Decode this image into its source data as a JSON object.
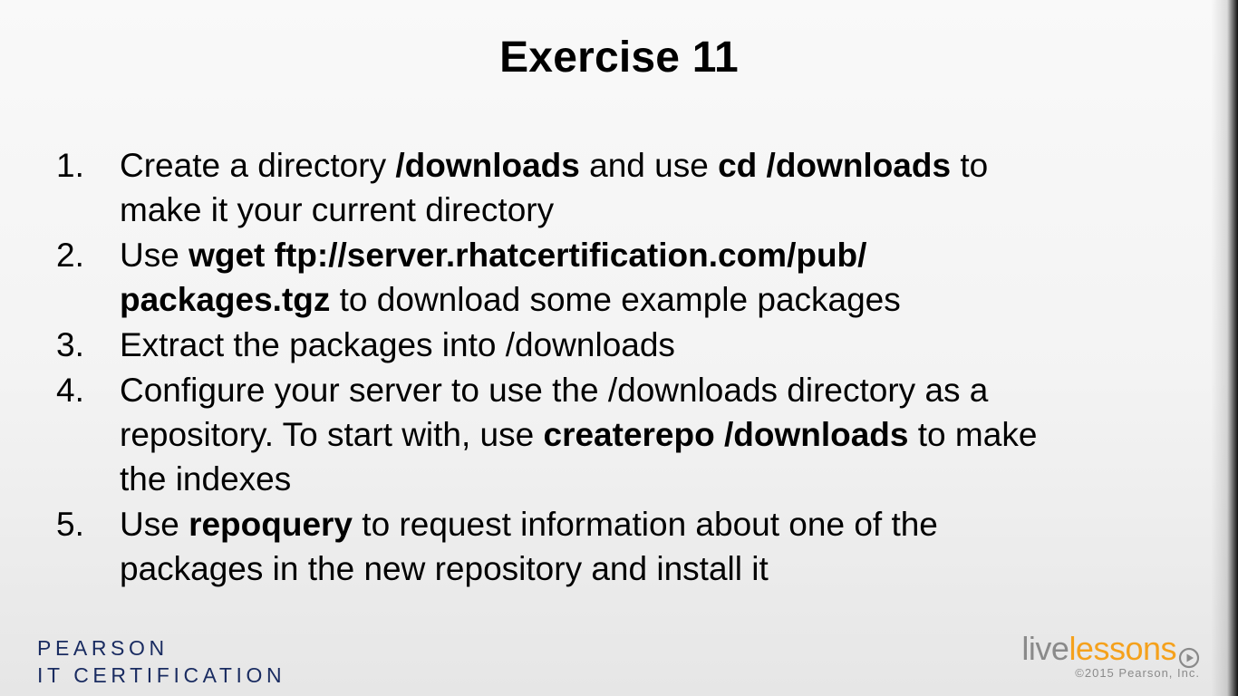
{
  "slide": {
    "title": "Exercise 11",
    "steps": [
      {
        "number": "1.",
        "line1": [
          {
            "text": "Create a directory ",
            "bold": false
          },
          {
            "text": "/downloads",
            "bold": true
          },
          {
            "text": " and use ",
            "bold": false
          },
          {
            "text": "cd /downloads",
            "bold": true
          },
          {
            "text": " to",
            "bold": false
          }
        ],
        "line2": [
          {
            "text": "make it your current directory",
            "bold": false
          }
        ]
      },
      {
        "number": "2.",
        "line1": [
          {
            "text": "Use ",
            "bold": false
          },
          {
            "text": "wget ftp://server.rhatcertification.com/pub/",
            "bold": true
          }
        ],
        "line2": [
          {
            "text": "packages.tgz",
            "bold": true
          },
          {
            "text": " to download some example packages",
            "bold": false
          }
        ]
      },
      {
        "number": "3.",
        "line1": [
          {
            "text": "Extract the packages into /downloads",
            "bold": false
          }
        ]
      },
      {
        "number": "4.",
        "line1": [
          {
            "text": "Configure your server to use the /downloads directory as a",
            "bold": false
          }
        ],
        "line2": [
          {
            "text": "repository. To start with, use ",
            "bold": false
          },
          {
            "text": "createrepo /downloads",
            "bold": true
          },
          {
            "text": " to make",
            "bold": false
          }
        ],
        "line3": [
          {
            "text": "the indexes",
            "bold": false
          }
        ]
      },
      {
        "number": "5.",
        "line1": [
          {
            "text": "Use ",
            "bold": false
          },
          {
            "text": "repoquery",
            "bold": true
          },
          {
            "text": " to request information about one of the",
            "bold": false
          }
        ],
        "line2": [
          {
            "text": "packages in the new repository and install it",
            "bold": false
          }
        ]
      }
    ]
  },
  "footer": {
    "publisher_line1": "PEARSON",
    "publisher_line2": "IT CERTIFICATION",
    "brand_live": "live",
    "brand_lessons": "lessons",
    "copyright": "©2015 Pearson, Inc."
  },
  "colors": {
    "publisher": "#1a2c61",
    "brand_live": "#8a8a8a",
    "brand_lessons": "#f5a11c"
  },
  "icons": {
    "brand_play": "play-circle-icon"
  }
}
